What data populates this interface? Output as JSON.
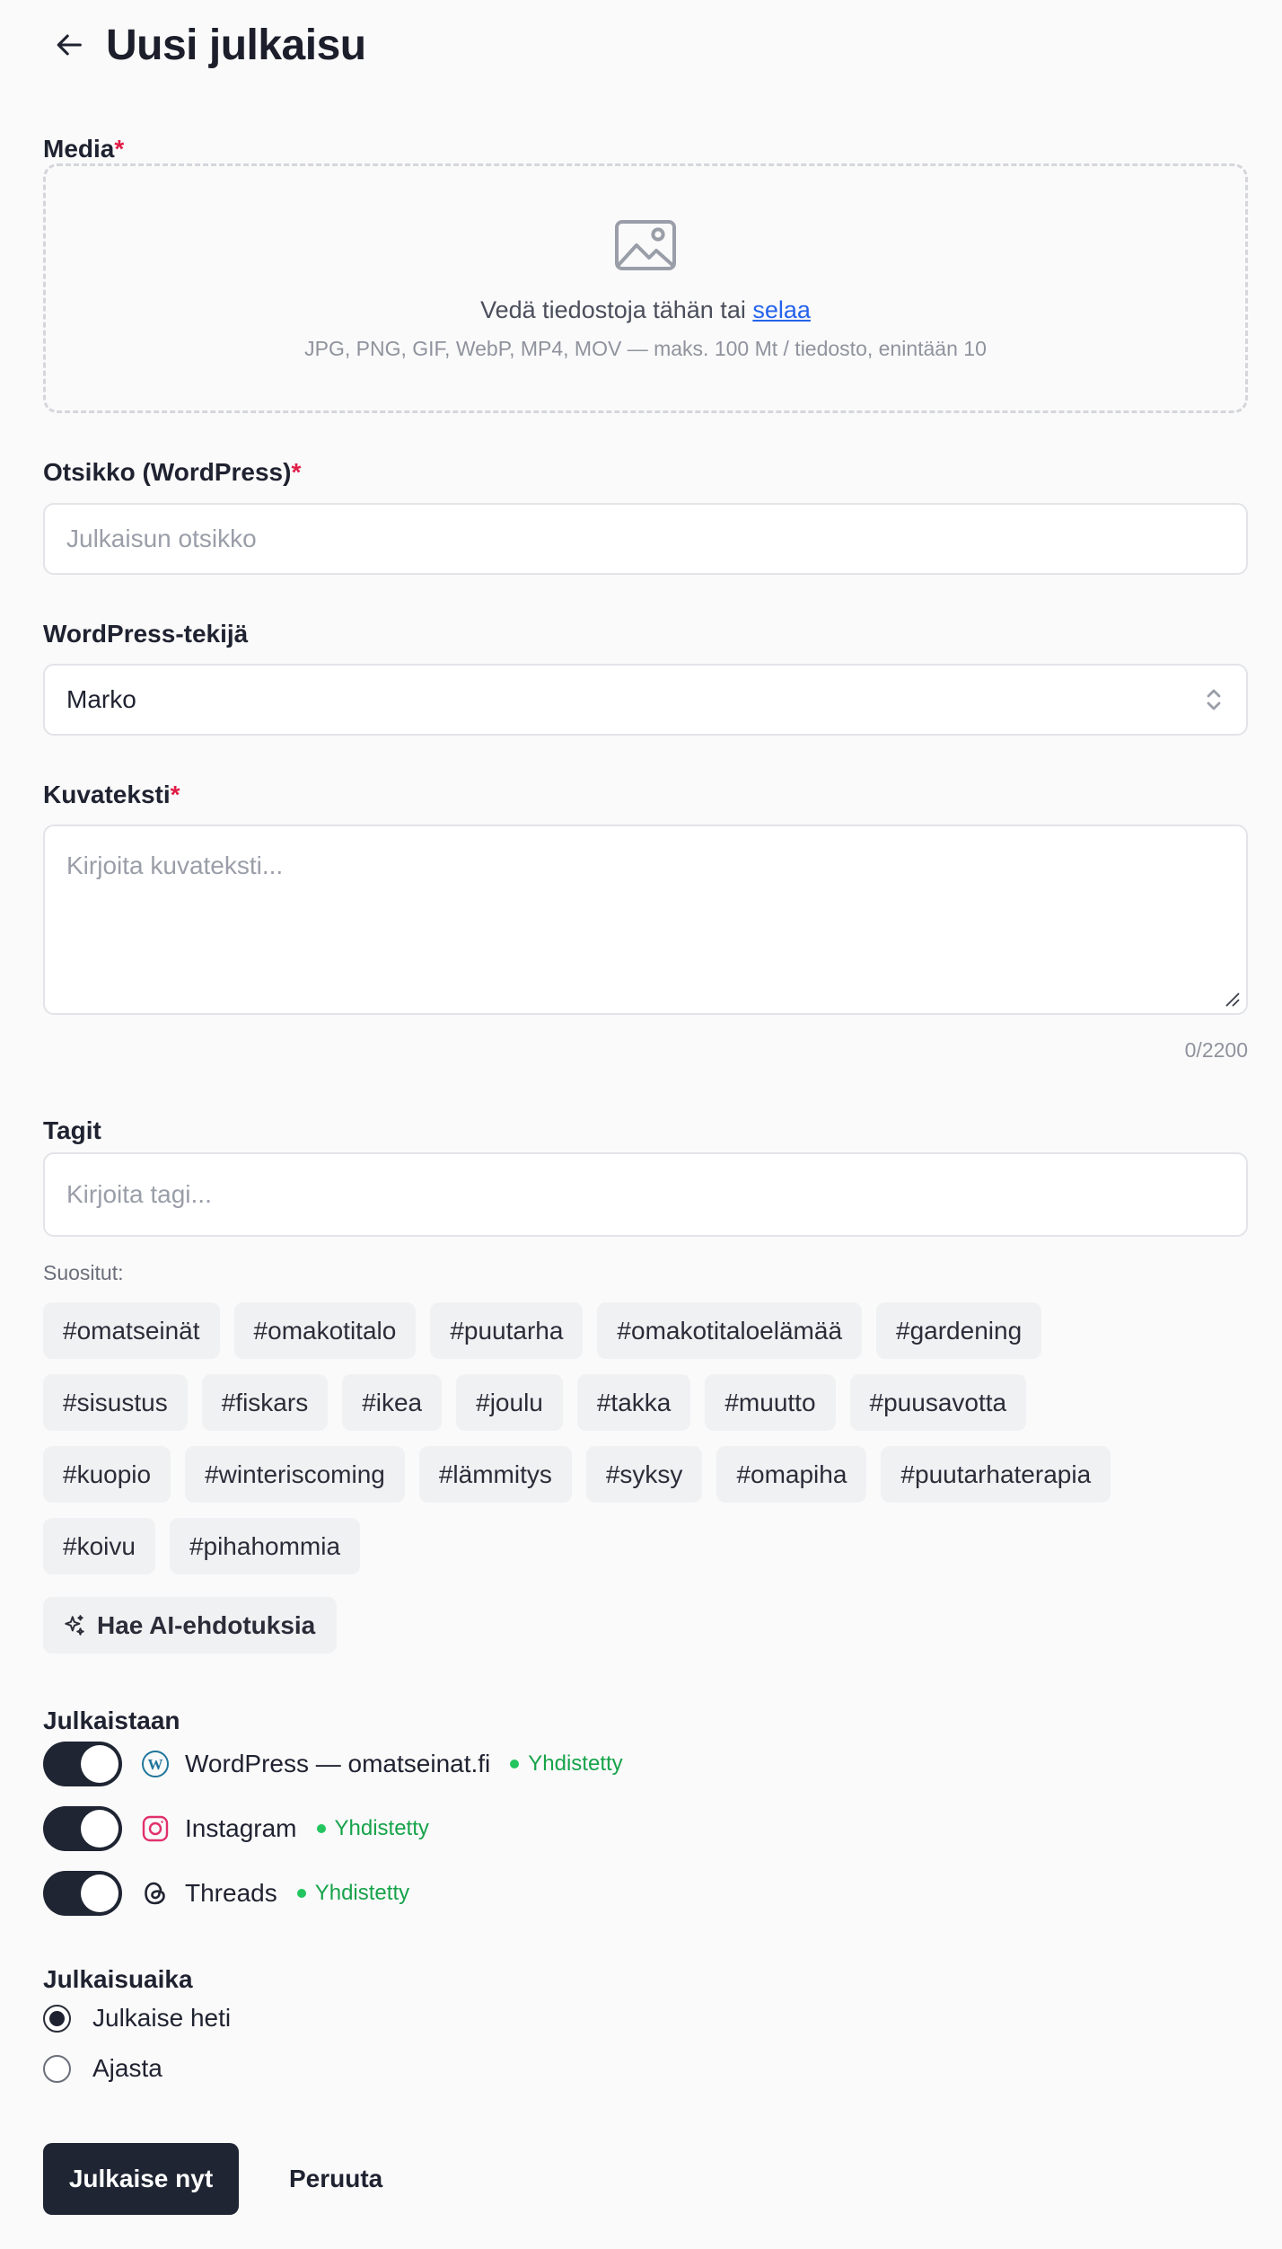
{
  "header": {
    "title": "Uusi julkaisu",
    "back_icon": "arrow-left-icon"
  },
  "media": {
    "label": "Media",
    "required_mark": "*",
    "drop_text": "Vedä tiedostoja tähän tai",
    "browse_link": "selaa",
    "hint": "JPG, PNG, GIF, WebP, MP4, MOV — maks. 100 Mt / tiedosto, enintään 10",
    "icon": "image-icon"
  },
  "title_field": {
    "label": "Otsikko (WordPress)",
    "required_mark": "*",
    "placeholder": "Julkaisun otsikko",
    "value": ""
  },
  "author_field": {
    "label": "WordPress-tekijä",
    "value": "Marko"
  },
  "caption_field": {
    "label": "Kuvateksti",
    "required_mark": "*",
    "placeholder": "Kirjoita kuvateksti...",
    "value": "",
    "counter": "0/2200"
  },
  "tags_field": {
    "label": "Tagit",
    "placeholder": "Kirjoita tagi...",
    "popular_label": "Suositut:",
    "rows": [
      [
        "#omatseinät",
        "#omakotitalo",
        "#puutarha",
        "#omakotitaloelämää",
        "#gardening"
      ],
      [
        "#sisustus",
        "#fiskars",
        "#ikea",
        "#joulu",
        "#takka",
        "#muutto",
        "#puusavotta"
      ],
      [
        "#kuopio",
        "#winteriscoming",
        "#lämmitys",
        "#syksy",
        "#omapiha",
        "#puutarhaterapia"
      ],
      [
        "#koivu",
        "#pihahommia"
      ]
    ],
    "ai_button": "Hae AI-ehdotuksia"
  },
  "publish_to": {
    "label": "Julkaistaan",
    "channels": [
      {
        "name": "WordPress — omatseinat.fi",
        "status": "Yhdistetty",
        "enabled": true,
        "icon": "wordpress-icon"
      },
      {
        "name": "Instagram",
        "status": "Yhdistetty",
        "enabled": true,
        "icon": "instagram-icon"
      },
      {
        "name": "Threads",
        "status": "Yhdistetty",
        "enabled": true,
        "icon": "threads-icon"
      }
    ],
    "status_color": "#16a34a"
  },
  "publish_time": {
    "label": "Julkaisuaika",
    "options": [
      {
        "label": "Julkaise heti",
        "selected": true
      },
      {
        "label": "Ajasta",
        "selected": false
      }
    ]
  },
  "actions": {
    "publish": "Julkaise nyt",
    "cancel": "Peruuta"
  },
  "colors": {
    "accent": "#1f2533",
    "link": "#2563eb",
    "required": "#e11d48"
  }
}
